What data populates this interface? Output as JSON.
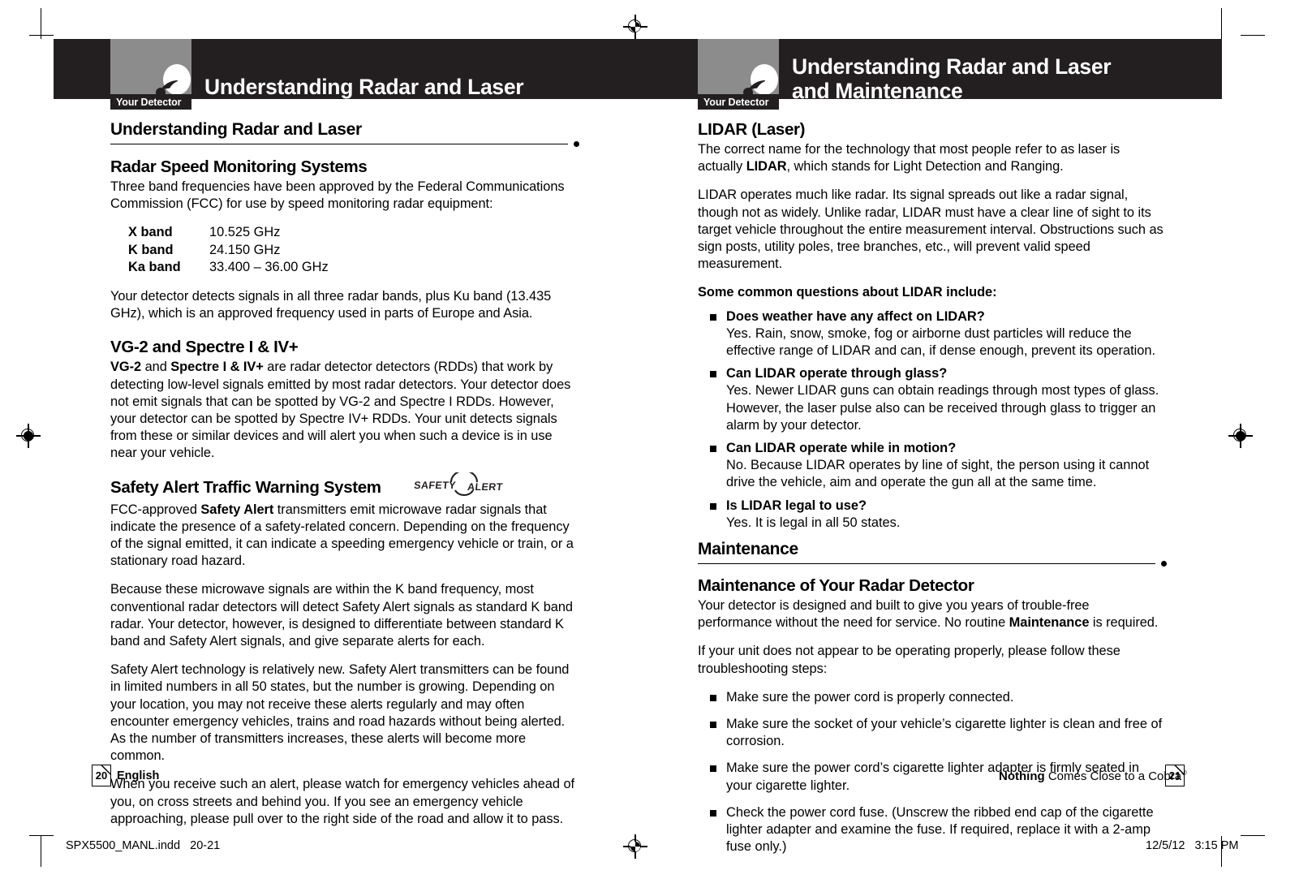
{
  "document": {
    "title": "Understanding Radar and Laser",
    "brand_tagline_bold": "Nothing",
    "brand_tagline_rest": " Comes Close to a Cobra",
    "registered_mark": "®"
  },
  "left_page": {
    "header": {
      "tab_label": "Your Detector",
      "title": "Understanding Radar and Laser",
      "logo_icon": "radar-dish-icon"
    },
    "section_heading": "Understanding Radar and Laser",
    "subheading_radar": "Radar Speed Monitoring Systems",
    "intro_paragraph": "Three band frequencies have been approved by the Federal Communications Commission (FCC) for use by speed monitoring radar equipment:",
    "bands": [
      {
        "name": "X band",
        "frequency": "10.525 GHz"
      },
      {
        "name": "K band",
        "frequency": "24.150 GHz"
      },
      {
        "name": "Ka band",
        "frequency": "33.400 – 36.00 GHz"
      }
    ],
    "bands_note": "Your detector detects signals in all three radar bands, plus Ku band (13.435 GHz), which is an approved frequency used in parts of Europe and Asia.",
    "subheading_vg2": "VG-2 and Spectre I & IV+",
    "vg2_bold_1": "VG-2",
    "vg2_mid": " and ",
    "vg2_bold_2": "Spectre I & IV+",
    "vg2_rest": " are radar detector detectors (RDDs) that work by detecting low-level signals emitted by most radar detectors. Your detector does not emit signals that can be spotted by VG-2 and Spectre I RDDs. However, your detector can be spotted by Spectre IV+ RDDs. Your unit detects signals from these or similar devices and will alert you when such a device is in use near your vehicle.",
    "subheading_safety": "Safety Alert Traffic Warning System",
    "safety_logo_text": "SAFETY ALERT",
    "safety_p1_pre": "FCC-approved ",
    "safety_p1_bold": "Safety Alert",
    "safety_p1_post": " transmitters emit microwave radar signals that indicate the presence of a safety-related concern. Depending on the frequency of the signal emitted, it can indicate a speeding emergency vehicle or train, or a stationary road hazard.",
    "safety_p2": "Because these microwave signals are within the K band frequency, most conventional radar detectors will detect Safety Alert signals as standard K band radar. Your detector, however, is designed to differentiate between standard K band and Safety Alert signals, and give separate alerts for each.",
    "safety_p3": "Safety Alert technology is relatively new. Safety Alert transmitters can be found in limited numbers in all 50 states, but the number is growing. Depending on your location, you may not receive these alerts regularly and may often encounter emergency vehicles, trains and road hazards without being alerted. As the number of transmitters increases, these alerts will become more common.",
    "safety_p4": "When you receive such an alert, please watch for emergency vehicles ahead of you, on cross streets and behind you. If you see an emergency vehicle approaching, please pull over to the right side of the road and allow it to pass.",
    "page_number": "20",
    "language": "English"
  },
  "right_page": {
    "header": {
      "tab_label": "Your Detector",
      "title_line1": "Understanding Radar and Laser",
      "title_line2": "and Maintenance",
      "logo_icon": "radar-dish-icon"
    },
    "subheading_lidar": "LIDAR (Laser)",
    "lidar_p1_pre": "The correct name for the technology that most people refer to as laser is actually ",
    "lidar_p1_bold": "LIDAR",
    "lidar_p1_post": ", which stands for Light Detection and Ranging.",
    "lidar_p2": "LIDAR operates much like radar. Its signal spreads out like a radar signal, though not as widely. Unlike radar, LIDAR must have a clear line of sight to its target vehicle throughout the entire measurement interval. Obstructions such as sign posts, utility poles, tree branches, etc., will prevent valid speed measurement.",
    "faq_heading": "Some common questions about LIDAR include:",
    "faq": [
      {
        "question": "Does weather have any affect on LIDAR?",
        "answer": "Yes. Rain, snow, smoke, fog or airborne dust particles will reduce the effective range of LIDAR and can, if dense enough, prevent its operation."
      },
      {
        "question": "Can LIDAR operate through glass?",
        "answer": "Yes. Newer LIDAR guns can obtain readings through most types of glass. However, the laser pulse also can be received through glass to trigger an alarm by your detector."
      },
      {
        "question": "Can LIDAR operate while in motion?",
        "answer": "No. Because LIDAR operates by line of sight, the person using it cannot drive the vehicle, aim and operate the gun all at the same time."
      },
      {
        "question": "Is LIDAR legal to use?",
        "answer": "Yes. It is legal in all 50 states."
      }
    ],
    "section_heading": "Maintenance",
    "subheading_maintenance": "Maintenance of Your Radar Detector",
    "maint_p1_pre": "Your detector is designed and built to give you years of trouble-free performance without the need for service. No routine ",
    "maint_p1_bold": "Maintenance",
    "maint_p1_post": " is required.",
    "maint_p2": "If your unit does not appear to be operating properly, please follow these troubleshooting steps:",
    "steps": [
      "Make sure the power cord is properly connected.",
      "Make sure the socket of your vehicle’s cigarette lighter is clean and free of corrosion.",
      "Make sure the power cord’s cigarette lighter adapter is firmly seated in your cigarette lighter.",
      "Check the power cord fuse. (Unscrew the ribbed end cap of the cigarette lighter adapter and examine the fuse. If required, replace it with a 2-amp fuse only.)"
    ],
    "page_number": "21"
  },
  "print_footer": {
    "filename": "SPX5500_MANL.indd   20-21",
    "timestamp": "12/5/12   3:15 PM"
  },
  "colors": {
    "header_black": "#231f20",
    "logo_plate_gray": "#8c8c8c",
    "text_black": "#000000",
    "page_white": "#ffffff"
  }
}
